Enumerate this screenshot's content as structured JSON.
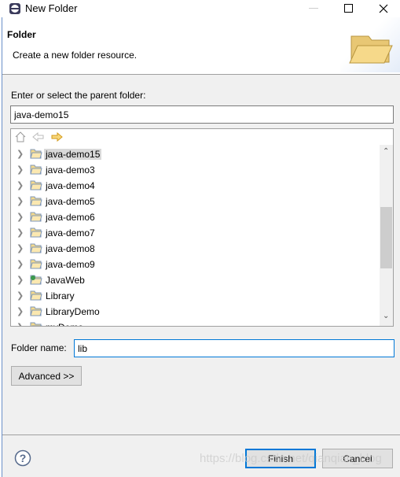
{
  "window": {
    "title": "New Folder",
    "minimize_icon": "minimize-icon",
    "maximize_icon": "maximize-icon",
    "close_icon": "close-icon"
  },
  "header": {
    "title": "Folder",
    "description": "Create a new folder resource."
  },
  "parent": {
    "label": "Enter or select the parent folder:",
    "value": "java-demo15"
  },
  "tree": {
    "items": [
      {
        "label": "java-demo15",
        "selected": true,
        "icon": "project-folder-icon"
      },
      {
        "label": "java-demo3",
        "icon": "project-folder-icon"
      },
      {
        "label": "java-demo4",
        "icon": "project-folder-icon"
      },
      {
        "label": "java-demo5",
        "icon": "project-folder-icon"
      },
      {
        "label": "java-demo6",
        "icon": "project-folder-icon"
      },
      {
        "label": "java-demo7",
        "icon": "project-folder-icon"
      },
      {
        "label": "java-demo8",
        "icon": "project-folder-icon"
      },
      {
        "label": "java-demo9",
        "icon": "project-folder-icon"
      },
      {
        "label": "JavaWeb",
        "icon": "web-project-icon"
      },
      {
        "label": "Library",
        "icon": "project-folder-icon"
      },
      {
        "label": "LibraryDemo",
        "icon": "project-folder-icon"
      },
      {
        "label": "myDemo",
        "icon": "project-folder-icon"
      }
    ]
  },
  "folder_name": {
    "label": "Folder name:",
    "value": "lib"
  },
  "advanced_label": "Advanced >>",
  "finish_label": "Finish",
  "cancel_label": "Cancel",
  "watermark": "https://blog.csdn.net/qianqian_blog",
  "colors": {
    "accent": "#0078d7",
    "folder": "#f0c860"
  }
}
